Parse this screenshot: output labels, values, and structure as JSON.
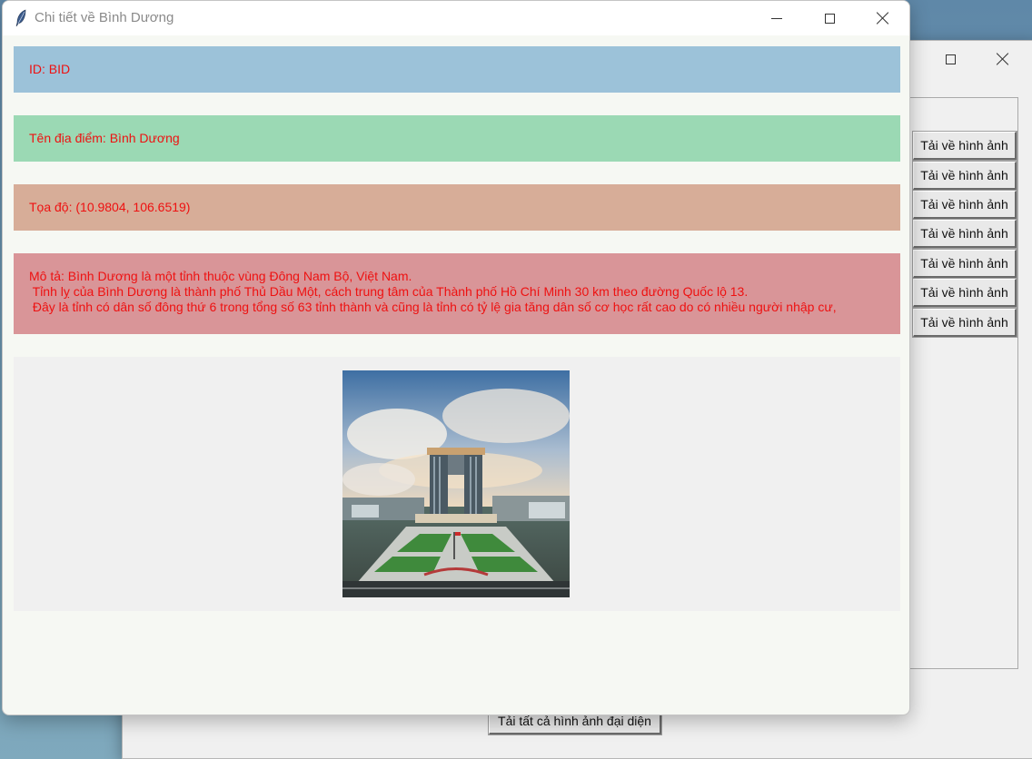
{
  "background_window": {
    "download_button_label": "Tải về hình ảnh",
    "download_buttons": [
      "Tải về hình ảnh",
      "Tải về hình ảnh",
      "Tải về hình ảnh",
      "Tải về hình ảnh",
      "Tải về hình ảnh",
      "Tải về hình ảnh",
      "Tải về hình ảnh"
    ],
    "download_all_label": "Tải tất cả hình ảnh đại diện"
  },
  "detail_window": {
    "title": "Chi tiết về Bình Dương",
    "icon": "feather-icon",
    "fields": {
      "id": "ID: BID",
      "name": "Tên địa điểm: Bình Dương",
      "coordinates": "Tọa độ: (10.9804, 106.6519)",
      "description": "Mô tả: Bình Dương là một tỉnh thuộc vùng Đông Nam Bộ, Việt Nam.\n Tỉnh lỵ của Bình Dương là thành phố Thủ Dầu Một, cách trung tâm của Thành phố Hồ Chí Minh 30 km theo đường Quốc lộ 13.\n Đây là tỉnh có dân số đông thứ 6 trong tổng số 63 tỉnh thành và cũng là tỉnh có tỷ lệ gia tăng dân số cơ học rất cao do có nhiều người nhập cư,"
    },
    "colors": {
      "id_bg": "#9cc2d9",
      "name_bg": "#9bd9b4",
      "coord_bg": "#d7ad98",
      "desc_bg": "#d99598",
      "text": "#ee1111"
    }
  }
}
